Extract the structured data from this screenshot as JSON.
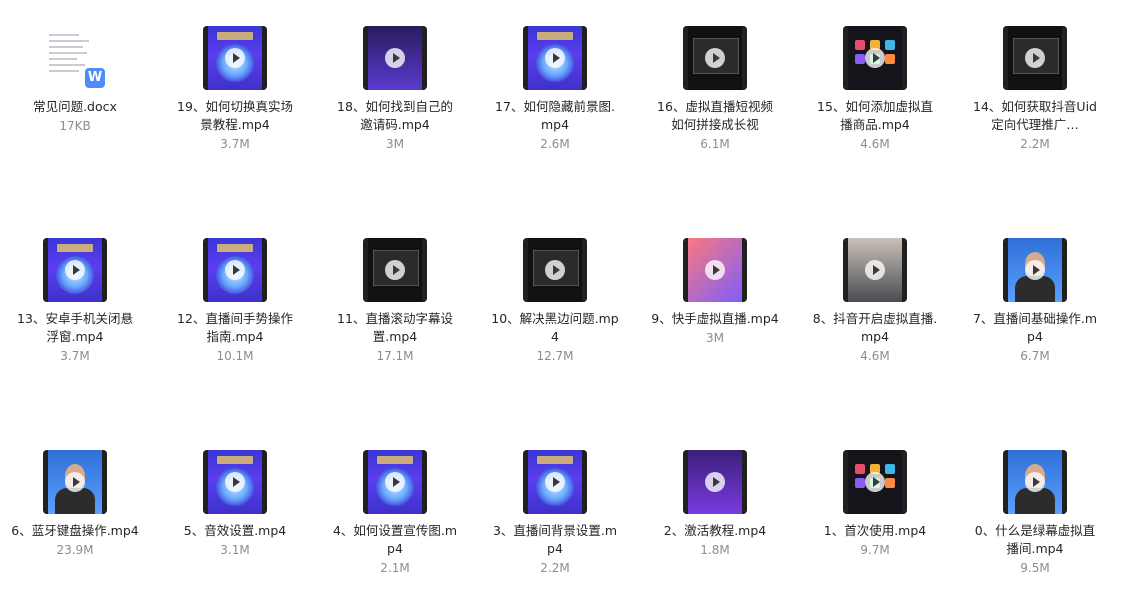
{
  "files": [
    {
      "name": "常见问题.docx",
      "size": "17KB",
      "thumb": "doc"
    },
    {
      "name": "19、如何切换真实场景教程.mp4",
      "size": "3.7M",
      "thumb": "blue"
    },
    {
      "name": "18、如何找到自己的邀请码.mp4",
      "size": "3M",
      "thumb": "purple"
    },
    {
      "name": "17、如何隐藏前景图.mp4",
      "size": "2.6M",
      "thumb": "blue"
    },
    {
      "name": "16、虚拟直播短视频如何拼接成长视",
      "size": "6.1M",
      "thumb": "dark"
    },
    {
      "name": "15、如何添加虚拟直播商品.mp4",
      "size": "4.6M",
      "thumb": "apps"
    },
    {
      "name": "14、如何获取抖音Uid定向代理推广…",
      "size": "2.2M",
      "thumb": "dark"
    },
    {
      "name": "13、安卓手机关闭悬浮窗.mp4",
      "size": "3.7M",
      "thumb": "blue"
    },
    {
      "name": "12、直播间手势操作指南.mp4",
      "size": "10.1M",
      "thumb": "blue"
    },
    {
      "name": "11、直播滚动字幕设置.mp4",
      "size": "17.1M",
      "thumb": "dark"
    },
    {
      "name": "10、解决黑边问题.mp4",
      "size": "12.7M",
      "thumb": "dark"
    },
    {
      "name": "9、快手虚拟直播.mp4",
      "size": "3M",
      "thumb": "pink"
    },
    {
      "name": "8、抖音开启虚拟直播.mp4",
      "size": "4.6M",
      "thumb": "photo"
    },
    {
      "name": "7、直播间基础操作.mp4",
      "size": "6.7M",
      "thumb": "person"
    },
    {
      "name": "6、蓝牙键盘操作.mp4",
      "size": "23.9M",
      "thumb": "person"
    },
    {
      "name": "5、音效设置.mp4",
      "size": "3.1M",
      "thumb": "blue"
    },
    {
      "name": "4、如何设置宣传图.mp4",
      "size": "2.1M",
      "thumb": "blue"
    },
    {
      "name": "3、直播间背景设置.mp4",
      "size": "2.2M",
      "thumb": "blue"
    },
    {
      "name": "2、激活教程.mp4",
      "size": "1.8M",
      "thumb": "purple2"
    },
    {
      "name": "1、首次使用.mp4",
      "size": "9.7M",
      "thumb": "apps"
    },
    {
      "name": "0、什么是绿幕虚拟直播间.mp4",
      "size": "9.5M",
      "thumb": "person"
    }
  ]
}
